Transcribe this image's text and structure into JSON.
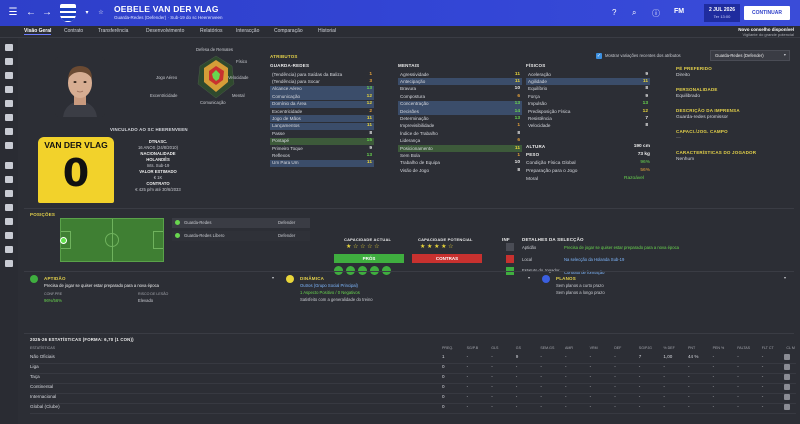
{
  "header": {
    "player_name": "OEBELE VAN DER VLAG",
    "subtitle": "Guarda-Redes (Defender) · Sub-19 do sc Heerenveen",
    "date_line1": "2 JUL 2026",
    "date_line2": "Ter 13:00",
    "fm": "FM",
    "continue_label": "CONTINUAR",
    "continue_sub": "Conselho disponível"
  },
  "advice": {
    "title": "Novo conselho disponível",
    "sub": "Vigilante do grande potencial"
  },
  "tabs": [
    "Visão Geral",
    "Contrato",
    "Transferência",
    "Desenvolvimento",
    "Relatórios",
    "Interacção",
    "Comparação",
    "Historial"
  ],
  "radar": {
    "labels": [
      "Defesa de Remates",
      "Físico",
      "Velocidade",
      "Mental",
      "Comunicação",
      "Excentricidade",
      "Jogo Aéreo"
    ]
  },
  "contract_card": {
    "section": "VINCULADO AO SC HEERENVEEN",
    "shirt_name": "VAN DER VLAG",
    "shirt_number": "0",
    "dob_label": "DTNASC.",
    "dob_value": "16 ANOS (24/8/2010)",
    "nationality_label": "NACIONALIDADE",
    "nationality_value": "HOLANDÊS",
    "caps_value": "Ints. Sub-19",
    "value_label": "VALOR ESTIMADO",
    "value_value": "€ 1K",
    "contract_label": "CONTRATO",
    "contract_value": "€ 425 p/m até 30/6/2033"
  },
  "attributes": {
    "title": "ATRIBUTOS",
    "show_changes_label": "Mostrar variações recentes dos atributos",
    "role_select": "Guarda-Redes (Defender)",
    "gk_title": "GUARDA-REDES",
    "mental_title": "MENTAIS",
    "phys_title": "FÍSICOS",
    "goalkeeping": [
      {
        "name": "(Tendência) para Saídas da Baliza",
        "value": "1"
      },
      {
        "name": "(Tendência) para Socar",
        "value": "3"
      },
      {
        "name": "Alcance Aéreo",
        "value": "13"
      },
      {
        "name": "Comunicação",
        "value": "12"
      },
      {
        "name": "Domínio da Área",
        "value": "12"
      },
      {
        "name": "Excentricidade",
        "value": "2"
      },
      {
        "name": "Jogo de Mãos",
        "value": "11"
      },
      {
        "name": "Lançamentos",
        "value": "11"
      },
      {
        "name": "Passe",
        "value": "8"
      },
      {
        "name": "Pontapé",
        "value": "15"
      },
      {
        "name": "Primeiro Toque",
        "value": "9"
      },
      {
        "name": "Reflexos",
        "value": "13"
      },
      {
        "name": "Um Para Um",
        "value": "11"
      }
    ],
    "mental": [
      {
        "name": "Agressividade",
        "value": "11"
      },
      {
        "name": "Antecipação",
        "value": "11"
      },
      {
        "name": "Bravura",
        "value": "10"
      },
      {
        "name": "Compostura",
        "value": "6"
      },
      {
        "name": "Concentração",
        "value": "13"
      },
      {
        "name": "Decisões",
        "value": "14"
      },
      {
        "name": "Determinação",
        "value": "13"
      },
      {
        "name": "Imprevisibilidade",
        "value": "1"
      },
      {
        "name": "Índice de Trabalho",
        "value": "8"
      },
      {
        "name": "Liderança",
        "value": "6"
      },
      {
        "name": "Posicionamento",
        "value": "11"
      },
      {
        "name": "Sem Bola",
        "value": "1"
      },
      {
        "name": "Trabalho de Equipa",
        "value": "10"
      },
      {
        "name": "Visão de Jogo",
        "value": "8"
      }
    ],
    "physical": [
      {
        "name": "Aceleração",
        "value": "9"
      },
      {
        "name": "Agilidade",
        "value": "11"
      },
      {
        "name": "Equilíbrio",
        "value": "8"
      },
      {
        "name": "Força",
        "value": "9"
      },
      {
        "name": "Impulsão",
        "value": "13"
      },
      {
        "name": "Predisposição Física",
        "value": "12"
      },
      {
        "name": "Resistência",
        "value": "7"
      },
      {
        "name": "Velocidade",
        "value": "8"
      }
    ],
    "height_label": "ALTURA",
    "height_value": "190 cm",
    "weight_label": "PESO",
    "weight_value": "73 kg",
    "condition_label": "Condição Física Global",
    "condition_value": "96%",
    "readiness_label": "Preparação para o Jogo",
    "readiness_value": "56%",
    "morale_label": "Moral",
    "morale_value": "Razoável"
  },
  "right_panel": {
    "foot_title": "PÉ PREFERIDO",
    "foot_value": "Direito",
    "personality_title": "PERSONALIDADE",
    "personality_value": "Equilibrado",
    "media_title": "DESCRIÇÃO DA IMPRENSA",
    "media_value": "Guarda-redes promissor",
    "ability_title": "CAPACI./JOG. CAMPO",
    "ability_value": "—",
    "traits_title": "CARACTERÍSTICAS DO JOGADOR",
    "traits_value": "Nenhum"
  },
  "positions": {
    "title": "POSIÇÕES",
    "rows": [
      {
        "name": "Guarda-Redes",
        "role": "Defender"
      },
      {
        "name": "Guarda-Redes Líbero",
        "role": "Defender"
      }
    ],
    "current_ability_label": "CAPACIDADE ACTUAL",
    "potential_ability_label": "CAPACIDADE POTENCIAL",
    "pros_label": "PRÓS",
    "cons_label": "CONTRAS"
  },
  "info": {
    "title": "INF",
    "details_title": "DETALHES DA SELECÇÃO",
    "rows": [
      {
        "label": "Aptidão",
        "value": "Precisa de jogar se quiser estar preparado para a nova época"
      },
      {
        "label": "Local",
        "value": "Na selecção da Holanda Sub-19"
      },
      {
        "label": "Estatuto do Jogador",
        "value": "Contrato de formação"
      }
    ]
  },
  "status_cards": {
    "fitness_title": "APTIDÃO",
    "fitness_text": "Precisa de jogar se quiser estar preparado para a nova época",
    "confidence_label": "CONF.PRE",
    "confidence_value": "96%/56%",
    "injury_label": "RISCO DE LESÃO",
    "injury_value": "Elevado",
    "dynamics_title": "DINÂMICA",
    "dynamics_line1": "Outros (Grupo Social Principal)",
    "dynamics_line2": "1 Aspecto Positivo / 0 Negativos",
    "dynamics_line3": "Satisfeito com a generalidade do treino",
    "plans_title": "PLANOS",
    "plans_line1": "Sem planos a curto prazo",
    "plans_line2": "Sem planos a longo prazo"
  },
  "stats": {
    "title": "2025-26 ESTATÍSTICAS (FORMA: 6,70 (1 CON))",
    "headers": [
      "ESTATÍSTICAS",
      "PREQ.",
      "SG/P.B",
      "GLS",
      "GS",
      "SEM.GS",
      "AMR",
      "VRM",
      "DEF",
      "SG/PJG",
      "% DEF",
      "PNT",
      "PEN %",
      "FALTAS",
      "FLT CT",
      "CL M"
    ],
    "rows": [
      {
        "name": "Não Oficiais",
        "cells": [
          "1",
          "-",
          "-",
          "9",
          "-",
          "-",
          "-",
          "-",
          "7",
          "1,00",
          "44 %",
          "-",
          "-",
          "-",
          "-",
          "6,70"
        ]
      },
      {
        "name": "Liga",
        "cells": [
          "0",
          "-",
          "-",
          "-",
          "-",
          "-",
          "-",
          "-",
          "-",
          "-",
          "-",
          "-",
          "-",
          "-",
          "-",
          "-"
        ]
      },
      {
        "name": "Taça",
        "cells": [
          "0",
          "-",
          "-",
          "-",
          "-",
          "-",
          "-",
          "-",
          "-",
          "-",
          "-",
          "-",
          "-",
          "-",
          "-",
          "-"
        ]
      },
      {
        "name": "Continental",
        "cells": [
          "0",
          "-",
          "-",
          "-",
          "-",
          "-",
          "-",
          "-",
          "-",
          "-",
          "-",
          "-",
          "-",
          "-",
          "-",
          "-"
        ]
      },
      {
        "name": "Internacional",
        "cells": [
          "0",
          "-",
          "-",
          "-",
          "-",
          "-",
          "-",
          "-",
          "-",
          "-",
          "-",
          "-",
          "-",
          "-",
          "-",
          "-"
        ]
      },
      {
        "name": "Global (Clube)",
        "cells": [
          "0",
          "-",
          "-",
          "-",
          "-",
          "-",
          "-",
          "-",
          "-",
          "-",
          "-",
          "-",
          "-",
          "-",
          "-",
          "-"
        ]
      }
    ]
  },
  "colors": {
    "accent": "#3346d6",
    "yellow": "#e6d34a",
    "green": "#69d64f",
    "red": "#c8312f"
  }
}
